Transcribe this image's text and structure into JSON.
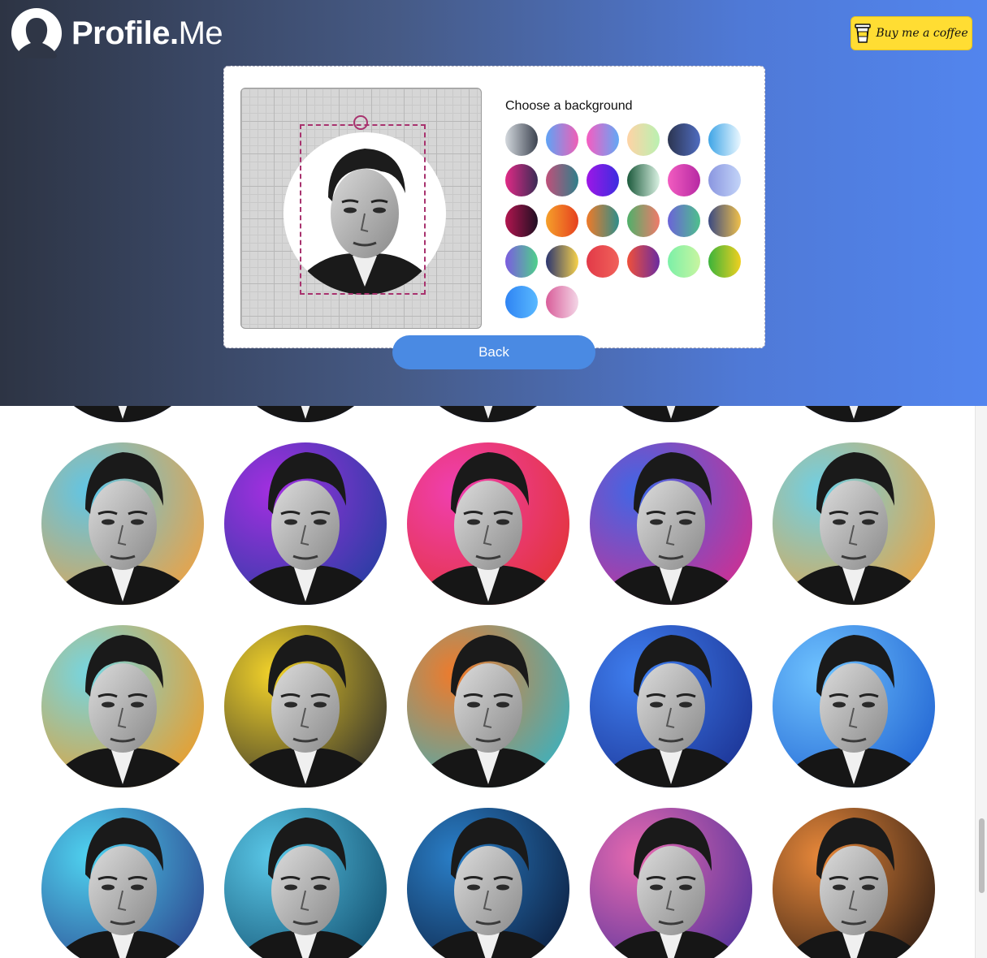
{
  "header": {
    "brand_bold": "Profile.",
    "brand_light": "Me",
    "coffee_label": "Buy me a coffee",
    "gradient": [
      "#2d3444",
      "#5285ee"
    ]
  },
  "editor": {
    "title": "Choose a background",
    "back_label": "Back",
    "selection_color": "#a8326e"
  },
  "backgrounds": [
    {
      "name": "gray-gradient",
      "from": "#d3d8dd",
      "to": "#3c4350"
    },
    {
      "name": "blue-pink",
      "from": "#5ea3f5",
      "to": "#f05fb6"
    },
    {
      "name": "pink-blue",
      "from": "#f75cc1",
      "to": "#62a8f5"
    },
    {
      "name": "pastel-rainbow",
      "from": "#ffd3a5",
      "to": "#b9f1b1"
    },
    {
      "name": "navy-blue",
      "from": "#2c3550",
      "to": "#4f6cc0"
    },
    {
      "name": "sky-white",
      "from": "#3fa5e6",
      "to": "#eaf7ff"
    },
    {
      "name": "magenta-navy",
      "from": "#e12a86",
      "to": "#3a2b55"
    },
    {
      "name": "mauve-teal",
      "from": "#c0507a",
      "to": "#2f7f8a"
    },
    {
      "name": "purple-blue",
      "from": "#9e16e6",
      "to": "#3b2ee0"
    },
    {
      "name": "green-white",
      "from": "#1c5a3c",
      "to": "#d9f1e2"
    },
    {
      "name": "pink-purple",
      "from": "#f25cc0",
      "to": "#b629a3"
    },
    {
      "name": "lavender-blue",
      "from": "#8a96e0",
      "to": "#c3d4f8"
    },
    {
      "name": "crimson-black",
      "from": "#b2154f",
      "to": "#1f0f22"
    },
    {
      "name": "orange-red",
      "from": "#f5a02a",
      "to": "#e6401f"
    },
    {
      "name": "orange-teal",
      "from": "#f07a28",
      "to": "#2e8e8a"
    },
    {
      "name": "green-coral",
      "from": "#4fb06a",
      "to": "#f07a6a"
    },
    {
      "name": "purple-green",
      "from": "#6b63d8",
      "to": "#4ec08c"
    },
    {
      "name": "navy-gold",
      "from": "#3b4a82",
      "to": "#f0c04a"
    },
    {
      "name": "blue-green",
      "from": "#7b5ce0",
      "to": "#4ed08a"
    },
    {
      "name": "navy-yellow",
      "from": "#2b3570",
      "to": "#f7d24a"
    },
    {
      "name": "red-coral",
      "from": "#e23a48",
      "to": "#f0615a"
    },
    {
      "name": "orange-purple",
      "from": "#f0503a",
      "to": "#6a2ca0"
    },
    {
      "name": "mint-green",
      "from": "#7cf0a8",
      "to": "#c8f5a0"
    },
    {
      "name": "rainbow",
      "from": "#3bb33b",
      "to": "#f0d020"
    },
    {
      "name": "blue-azure",
      "from": "#2f84f3",
      "to": "#59b9ff"
    },
    {
      "name": "pink-white",
      "from": "#d95d9a",
      "to": "#f3d6e6"
    }
  ],
  "gallery": [
    {
      "name": "partial-1",
      "bg1": "#3b6bd6",
      "bg2": "#8f3ad0"
    },
    {
      "name": "partial-2",
      "bg1": "#3b6bd6",
      "bg2": "#8f3ad0"
    },
    {
      "name": "partial-3",
      "bg1": "#3b6bd6",
      "bg2": "#8f3ad0"
    },
    {
      "name": "partial-4",
      "bg1": "#3b6bd6",
      "bg2": "#8f3ad0"
    },
    {
      "name": "partial-5",
      "bg1": "#3b6bd6",
      "bg2": "#8f3ad0"
    },
    {
      "name": "flowers",
      "bg1": "#f5a03a",
      "bg2": "#5ec6e8"
    },
    {
      "name": "neon-swirl",
      "bg1": "#1f3f9e",
      "bg2": "#a32fe0"
    },
    {
      "name": "rainbow-waves",
      "bg1": "#e2332f",
      "bg2": "#f03fb0"
    },
    {
      "name": "pink-lines",
      "bg1": "#d92b8c",
      "bg2": "#3f67e6"
    },
    {
      "name": "flowers-2",
      "bg1": "#f0a23a",
      "bg2": "#6ed0e6"
    },
    {
      "name": "sunset-stripes",
      "bg1": "#f29a1f",
      "bg2": "#74d6e3"
    },
    {
      "name": "graffiti",
      "bg1": "#2b2b2b",
      "bg2": "#f2d22a"
    },
    {
      "name": "psychedelic",
      "bg1": "#2fb5c8",
      "bg2": "#f07a2a"
    },
    {
      "name": "blue-wave",
      "bg1": "#1a2f8f",
      "bg2": "#3f7ff0"
    },
    {
      "name": "circuit",
      "bg1": "#1d5fd0",
      "bg2": "#6fc3ff"
    },
    {
      "name": "neon-tunnel",
      "bg1": "#2a3f8a",
      "bg2": "#4fd3f0"
    },
    {
      "name": "tech-blue",
      "bg1": "#0f4a6a",
      "bg2": "#5ac8e8"
    },
    {
      "name": "code-screen",
      "bg1": "#0b1b3a",
      "bg2": "#2a7fc8"
    },
    {
      "name": "galaxy",
      "bg1": "#4a2f9a",
      "bg2": "#e86ab0"
    },
    {
      "name": "planet",
      "bg1": "#2a1a12",
      "bg2": "#e8883a"
    }
  ]
}
